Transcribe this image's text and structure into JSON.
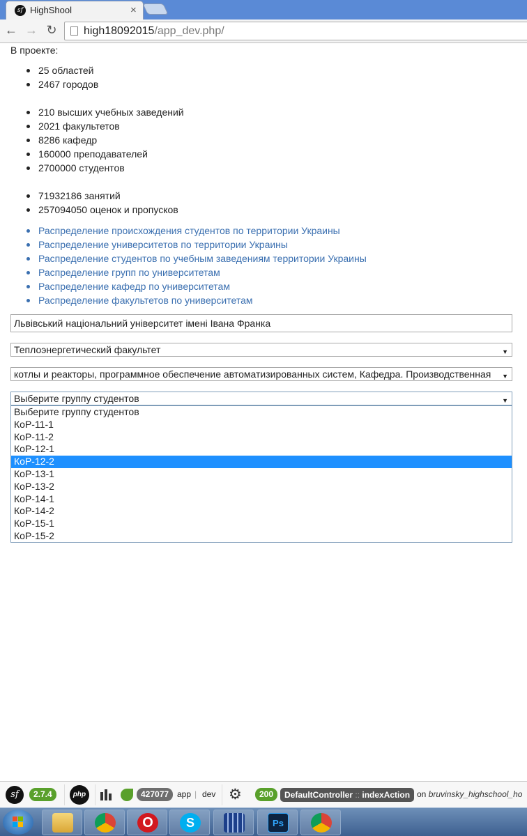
{
  "browser": {
    "tab_title": "HighShool",
    "tab_favicon": "sf",
    "tab_close": "×",
    "back": "←",
    "forward": "→",
    "reload": "↻",
    "url_host": "high18092015",
    "url_path": "/app_dev.php/"
  },
  "page": {
    "intro": "В проекте:",
    "stats_group1": [
      "25 областей",
      "2467 городов"
    ],
    "stats_group2": [
      "210 высших учебных заведений",
      "2021 факультетов",
      "8286 кафедр",
      "160000 преподавателей",
      "2700000 студентов"
    ],
    "stats_group3": [
      "71932186 занятий",
      "257094050 оценок и пропусков"
    ],
    "links": [
      "Распределение происхождения студентов по территории Украины",
      "Распределение университетов по территории Украины",
      "Распределение студентов по учебным заведениям территории Украины",
      "Распределение групп по университетам",
      "Распределение кафедр по университетам",
      "Распределение факультетов по университетам"
    ],
    "university_input": "Львівський національний університет імені Івана Франка",
    "faculty_select": "Теплоэнергетический факультет",
    "department_select": "котлы и реакторы, программное обеспечение автоматизированных систем, Кафедра. Производственная",
    "group_select": "Выберите группу студентов",
    "group_options": [
      "Выберите группу студентов",
      "КоР-11-1",
      "КоР-11-2",
      "КоР-12-1",
      "КоР-12-2",
      "КоР-13-1",
      "КоР-13-2",
      "КоР-14-1",
      "КоР-14-2",
      "КоР-15-1",
      "КоР-15-2"
    ],
    "group_selected": "КоР-12-2",
    "select_arrow": "▼"
  },
  "sf_toolbar": {
    "logo": "sf",
    "symfony_version": "2.7.4",
    "php_logo": "php",
    "token": "427077",
    "app_name": "app",
    "env_sep": "|",
    "environment": "dev",
    "status_code": "200",
    "controller": "DefaultController",
    "controller_sep": "::",
    "action": "indexAction",
    "on_label": "on",
    "route": "bruvinsky_highschool_ho"
  },
  "taskbar": {
    "apps": [
      "file-explorer-icon",
      "chrome-icon",
      "opera-icon",
      "skype-icon",
      "archive-icon",
      "photoshop-icon",
      "chrome-icon"
    ],
    "opera_glyph": "O",
    "skype_glyph": "S",
    "ps_glyph": "Ps"
  },
  "colors": {
    "link": "#3a6fb0",
    "selected_option": "#1e90ff",
    "badge_green": "#59a02b",
    "tabstrip": "#5a8ad6"
  }
}
